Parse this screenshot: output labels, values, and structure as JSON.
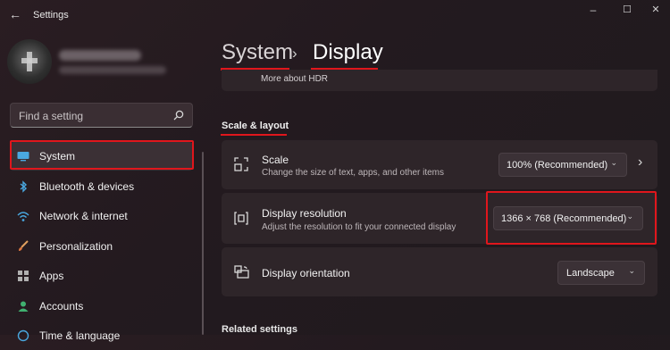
{
  "window": {
    "title": "Settings",
    "back_glyph": "←",
    "minimize_glyph": "–",
    "maximize_glyph": "☐",
    "close_glyph": "✕"
  },
  "search": {
    "placeholder": "Find a setting"
  },
  "nav": {
    "items": [
      {
        "label": "System",
        "icon": "monitor-icon",
        "active": true
      },
      {
        "label": "Bluetooth & devices",
        "icon": "bluetooth-icon"
      },
      {
        "label": "Network & internet",
        "icon": "wifi-icon"
      },
      {
        "label": "Personalization",
        "icon": "brush-icon"
      },
      {
        "label": "Apps",
        "icon": "apps-icon"
      },
      {
        "label": "Accounts",
        "icon": "person-icon"
      },
      {
        "label": "Time & language",
        "icon": "clock-globe-icon"
      }
    ]
  },
  "breadcrumb": {
    "parent": "System",
    "separator": "›",
    "current": "Display"
  },
  "partial_item": {
    "label": "More about HDR"
  },
  "section": {
    "title": "Scale & layout"
  },
  "settings": {
    "scale": {
      "title": "Scale",
      "subtitle": "Change the size of text, apps, and other items",
      "value": "100% (Recommended)",
      "chevron": "⌄",
      "arrow": "›"
    },
    "resolution": {
      "title": "Display resolution",
      "subtitle": "Adjust the resolution to fit your connected display",
      "value": "1366 × 768 (Recommended)",
      "chevron": "⌄"
    },
    "orientation": {
      "title": "Display orientation",
      "value": "Landscape",
      "chevron": "⌄"
    }
  },
  "related": {
    "title": "Related settings"
  },
  "colors": {
    "accent": "#e0161c",
    "system_icon": "#4aa8e0"
  }
}
